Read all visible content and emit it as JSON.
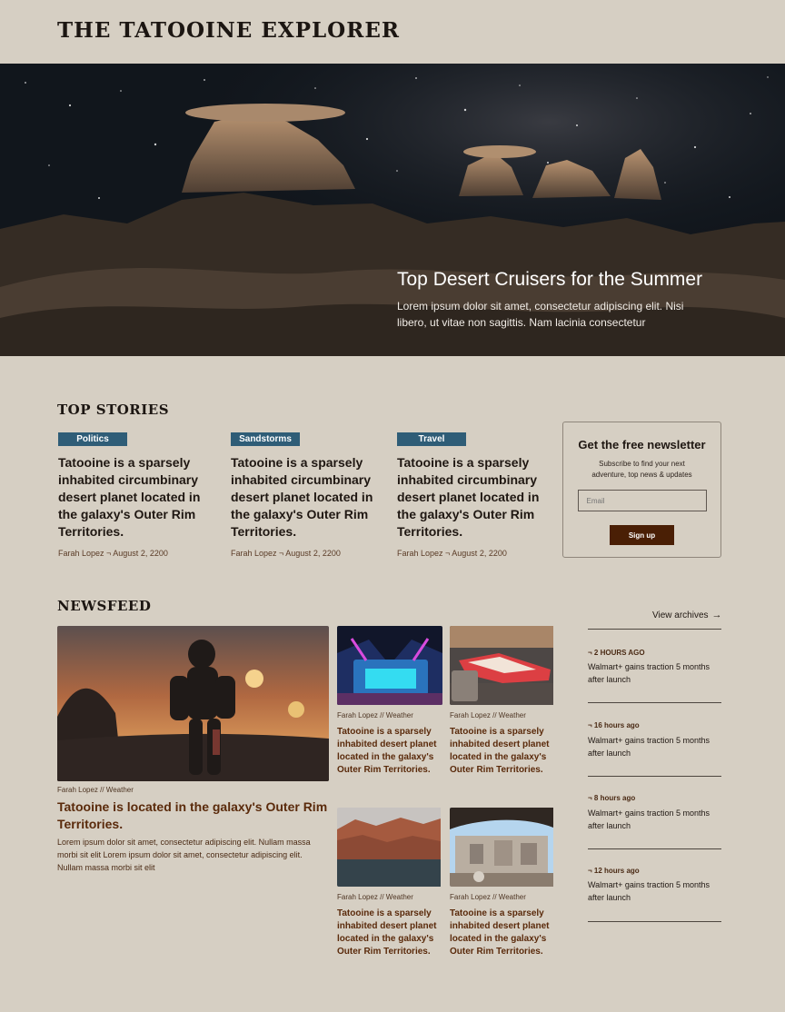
{
  "site": {
    "title": "THE TATOOINE EXPLORER"
  },
  "hero": {
    "title": "Top Desert Cruisers for the Summer",
    "description": "Lorem ipsum dolor sit amet, consectetur adipiscing elit. Nisi libero, ut vitae non sagittis. Nam lacinia consectetur"
  },
  "top_stories": {
    "heading": "TOP STORIES",
    "items": [
      {
        "tag": "Politics",
        "headline": "Tatooine is a sparsely inhabited circumbinary desert planet located in the galaxy's Outer Rim Territories.",
        "meta": "Farah Lopez ¬ August 2, 2200"
      },
      {
        "tag": "Sandstorms",
        "headline": "Tatooine is a sparsely inhabited circumbinary desert planet located in the galaxy's Outer Rim Territories.",
        "meta": "Farah Lopez ¬ August 2, 2200"
      },
      {
        "tag": "Travel",
        "headline": "Tatooine is a sparsely inhabited circumbinary desert planet located in the galaxy's Outer Rim Territories.",
        "meta": "Farah Lopez ¬ August 2, 2200"
      }
    ]
  },
  "newsletter": {
    "title": "Get the free newsletter",
    "subtitle": "Subscribe to find your next adventure, top news & updates",
    "email_placeholder": "Email",
    "button_label": "Sign up",
    "button_color": "#4a1f05"
  },
  "newsfeed": {
    "heading": "NEWSFEED",
    "main": {
      "meta": "Farah Lopez // Weather",
      "title": "Tatooine is located in the galaxy's Outer Rim Territories.",
      "text": "Lorem ipsum dolor sit amet, consectetur adipiscing elit. Nullam massa morbi sit elit Lorem ipsum dolor sit amet, consectetur adipiscing elit. Nullam massa morbi sit elit"
    },
    "cards": [
      {
        "meta": "Farah Lopez // Weather",
        "title": "Tatooine is a sparsely inhabited desert planet located in the galaxy's Outer Rim Territories."
      },
      {
        "meta": "Farah Lopez // Weather",
        "title": "Tatooine is a sparsely inhabited desert planet located in the galaxy's Outer Rim Territories."
      },
      {
        "meta": "Farah Lopez // Weather",
        "title": "Tatooine is a sparsely inhabited desert planet located in the galaxy's Outer Rim Territories."
      },
      {
        "meta": "Farah Lopez // Weather",
        "title": "Tatooine is a sparsely inhabited desert planet located in the galaxy's Outer Rim Territories."
      }
    ]
  },
  "sidebar": {
    "archive_label": "View archives",
    "arrow_icon": "arrow-right-icon",
    "items": [
      {
        "time": "¬ 2 HOURS AGO",
        "title": "Walmart+ gains traction 5 months after launch"
      },
      {
        "time": "¬ 16 hours ago",
        "title": "Walmart+ gains traction 5 months after launch"
      },
      {
        "time": "¬ 8 hours ago",
        "title": "Walmart+ gains traction 5 months after launch"
      },
      {
        "time": "¬ 12 hours ago",
        "title": "Walmart+ gains traction 5 months after launch"
      }
    ]
  },
  "colors": {
    "background": "#d6cfc3",
    "tag": "#2f5d77",
    "link": "#5a2a0b"
  }
}
